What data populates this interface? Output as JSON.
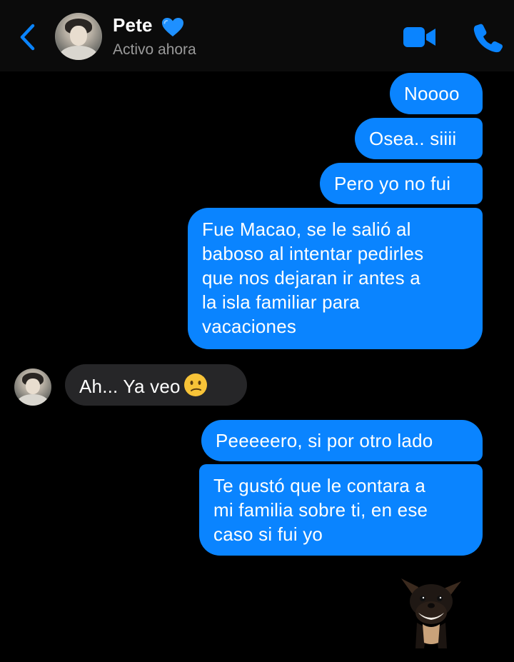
{
  "header": {
    "back_icon": "chevron-left-icon",
    "contact_name": "Pete",
    "name_emoji": "blue-heart-icon",
    "status": "Activo ahora",
    "video_icon": "video-camera-icon",
    "phone_icon": "phone-icon"
  },
  "messages": [
    {
      "from": "me",
      "text": "Noooo"
    },
    {
      "from": "me",
      "text": "Osea.. siiii"
    },
    {
      "from": "me",
      "text": "Pero yo no fui"
    },
    {
      "from": "me",
      "text": "Fue Macao, se le salió al\nbaboso al intentar pedirles\nque nos dejaran ir antes a\nla isla familiar para\nvacaciones"
    },
    {
      "from": "them",
      "text": "Ah... Ya veo",
      "emoji": "confused-face-icon"
    },
    {
      "from": "me",
      "text": "Peeeeero, si por otro lado"
    },
    {
      "from": "me",
      "text": "Te gustó que le contara a\nmi familia sobre ti, en ese\ncaso si fui yo"
    }
  ],
  "sticker": "laughing-chihuahua-sticker",
  "colors": {
    "outgoing_bubble": "#0a84ff",
    "incoming_bubble": "#262628",
    "accent": "#0a84ff",
    "background": "#000000",
    "status_text": "#9a9a9a"
  }
}
